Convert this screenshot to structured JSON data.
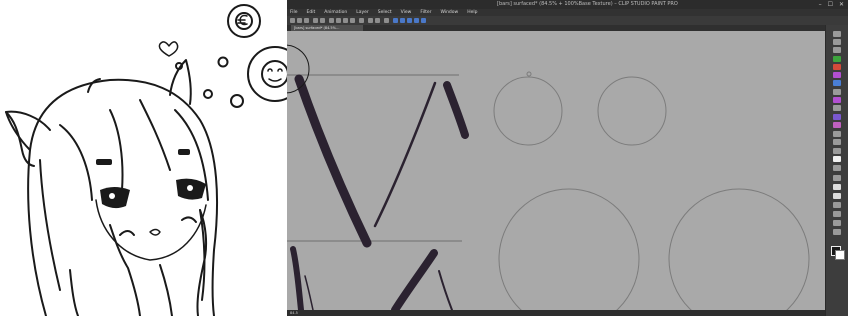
{
  "app": {
    "title": "[bars] surfaced* (84.5% + 100%Base Texture) – CLIP STUDIO PAINT PRO",
    "window_controls": [
      "–",
      "☐",
      "✕"
    ],
    "menu": [
      "File",
      "Edit",
      "Animation",
      "Layer",
      "Select",
      "View",
      "Filter",
      "Window",
      "Help"
    ],
    "tab_label": "[bars] surfaced* (84.5%…",
    "status_text": "84.5"
  },
  "icons": {
    "window": [
      "minimize-icon",
      "maximize-icon",
      "close-icon"
    ],
    "toolbox": [
      "zoom-icon",
      "move-icon",
      "select-icon",
      "lasso-icon",
      "eyedropper-icon",
      "pen-icon",
      "pencil-icon",
      "brush-icon",
      "airbrush-icon",
      "decoration-icon",
      "eraser-icon",
      "fill-icon",
      "gradient-icon",
      "figure-icon",
      "text-icon",
      "balloon-icon",
      "ruler-icon"
    ]
  },
  "colors": {
    "canvas_gray": "#a9a9a9",
    "stroke_dark": "#2b2230",
    "foreground_color": "#1a1a1a",
    "background_color": "#ffffff"
  }
}
